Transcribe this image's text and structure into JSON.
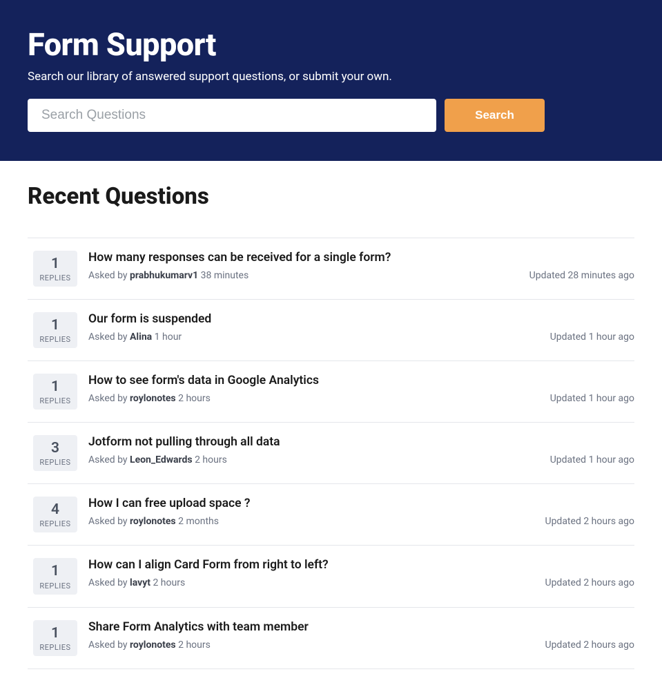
{
  "hero": {
    "title": "Form Support",
    "subtitle": "Search our library of answered support questions, or submit your own.",
    "search_placeholder": "Search Questions",
    "search_button": "Search"
  },
  "section": {
    "recent_title": "Recent Questions"
  },
  "labels": {
    "replies": "REPLIES",
    "asked_by": "Asked by",
    "updated": "Updated"
  },
  "questions": [
    {
      "replies": "1",
      "title": "How many responses can be received for a single form?",
      "author": "prabhukumarv1",
      "asked_ago": "38 minutes",
      "updated_ago": "28 minutes ago"
    },
    {
      "replies": "1",
      "title": "Our form is suspended",
      "author": "Alina",
      "asked_ago": "1 hour",
      "updated_ago": "1 hour ago"
    },
    {
      "replies": "1",
      "title": "How to see form's data in Google Analytics",
      "author": "roylonotes",
      "asked_ago": "2 hours",
      "updated_ago": "1 hour ago"
    },
    {
      "replies": "3",
      "title": "Jotform not pulling through all data",
      "author": "Leon_Edwards",
      "asked_ago": "2 hours",
      "updated_ago": "1 hour ago"
    },
    {
      "replies": "4",
      "title": "How I can free upload space ?",
      "author": "roylonotes",
      "asked_ago": "2 months",
      "updated_ago": "2 hours ago"
    },
    {
      "replies": "1",
      "title": "How can I align Card Form from right to left?",
      "author": "lavyt",
      "asked_ago": "2 hours",
      "updated_ago": "2 hours ago"
    },
    {
      "replies": "1",
      "title": "Share Form Analytics with team member",
      "author": "roylonotes",
      "asked_ago": "2 hours",
      "updated_ago": "2 hours ago"
    }
  ]
}
